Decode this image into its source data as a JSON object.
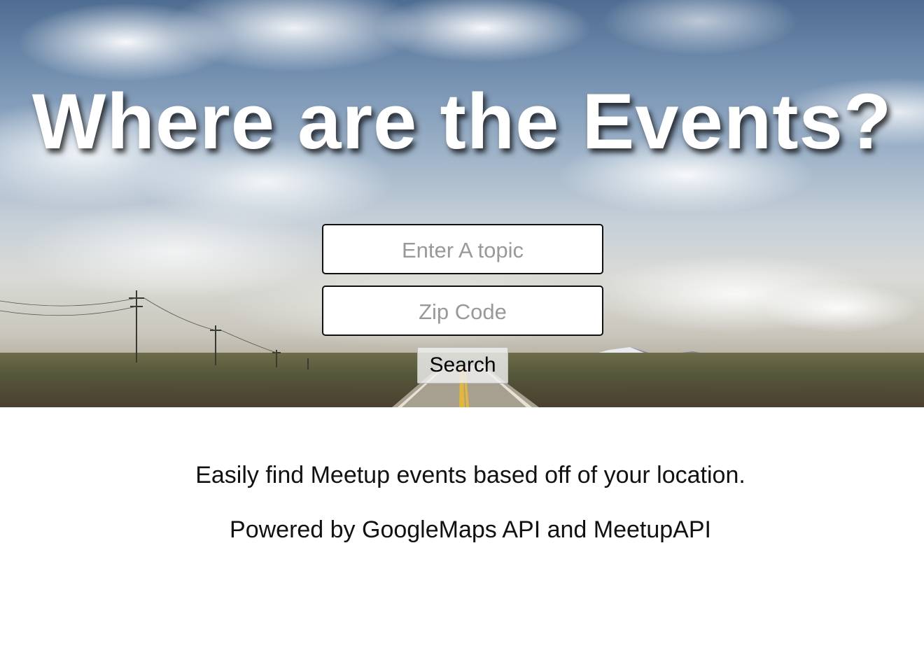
{
  "hero": {
    "title": "Where are the Events?"
  },
  "form": {
    "topic_placeholder": "Enter A topic",
    "topic_value": "",
    "zip_placeholder": "Zip Code",
    "zip_value": "",
    "search_label": "Search"
  },
  "info": {
    "tagline": "Easily find Meetup events based off of your location.",
    "powered_by": "Powered by GoogleMaps API and MeetupAPI"
  },
  "colors": {
    "title_text": "#ffffff",
    "page_background": "#ffffff",
    "body_text": "#111111",
    "field_border": "#111111",
    "placeholder_text": "#999999"
  },
  "icons": {
    "hero_background": "sky-road-landscape-photo"
  }
}
